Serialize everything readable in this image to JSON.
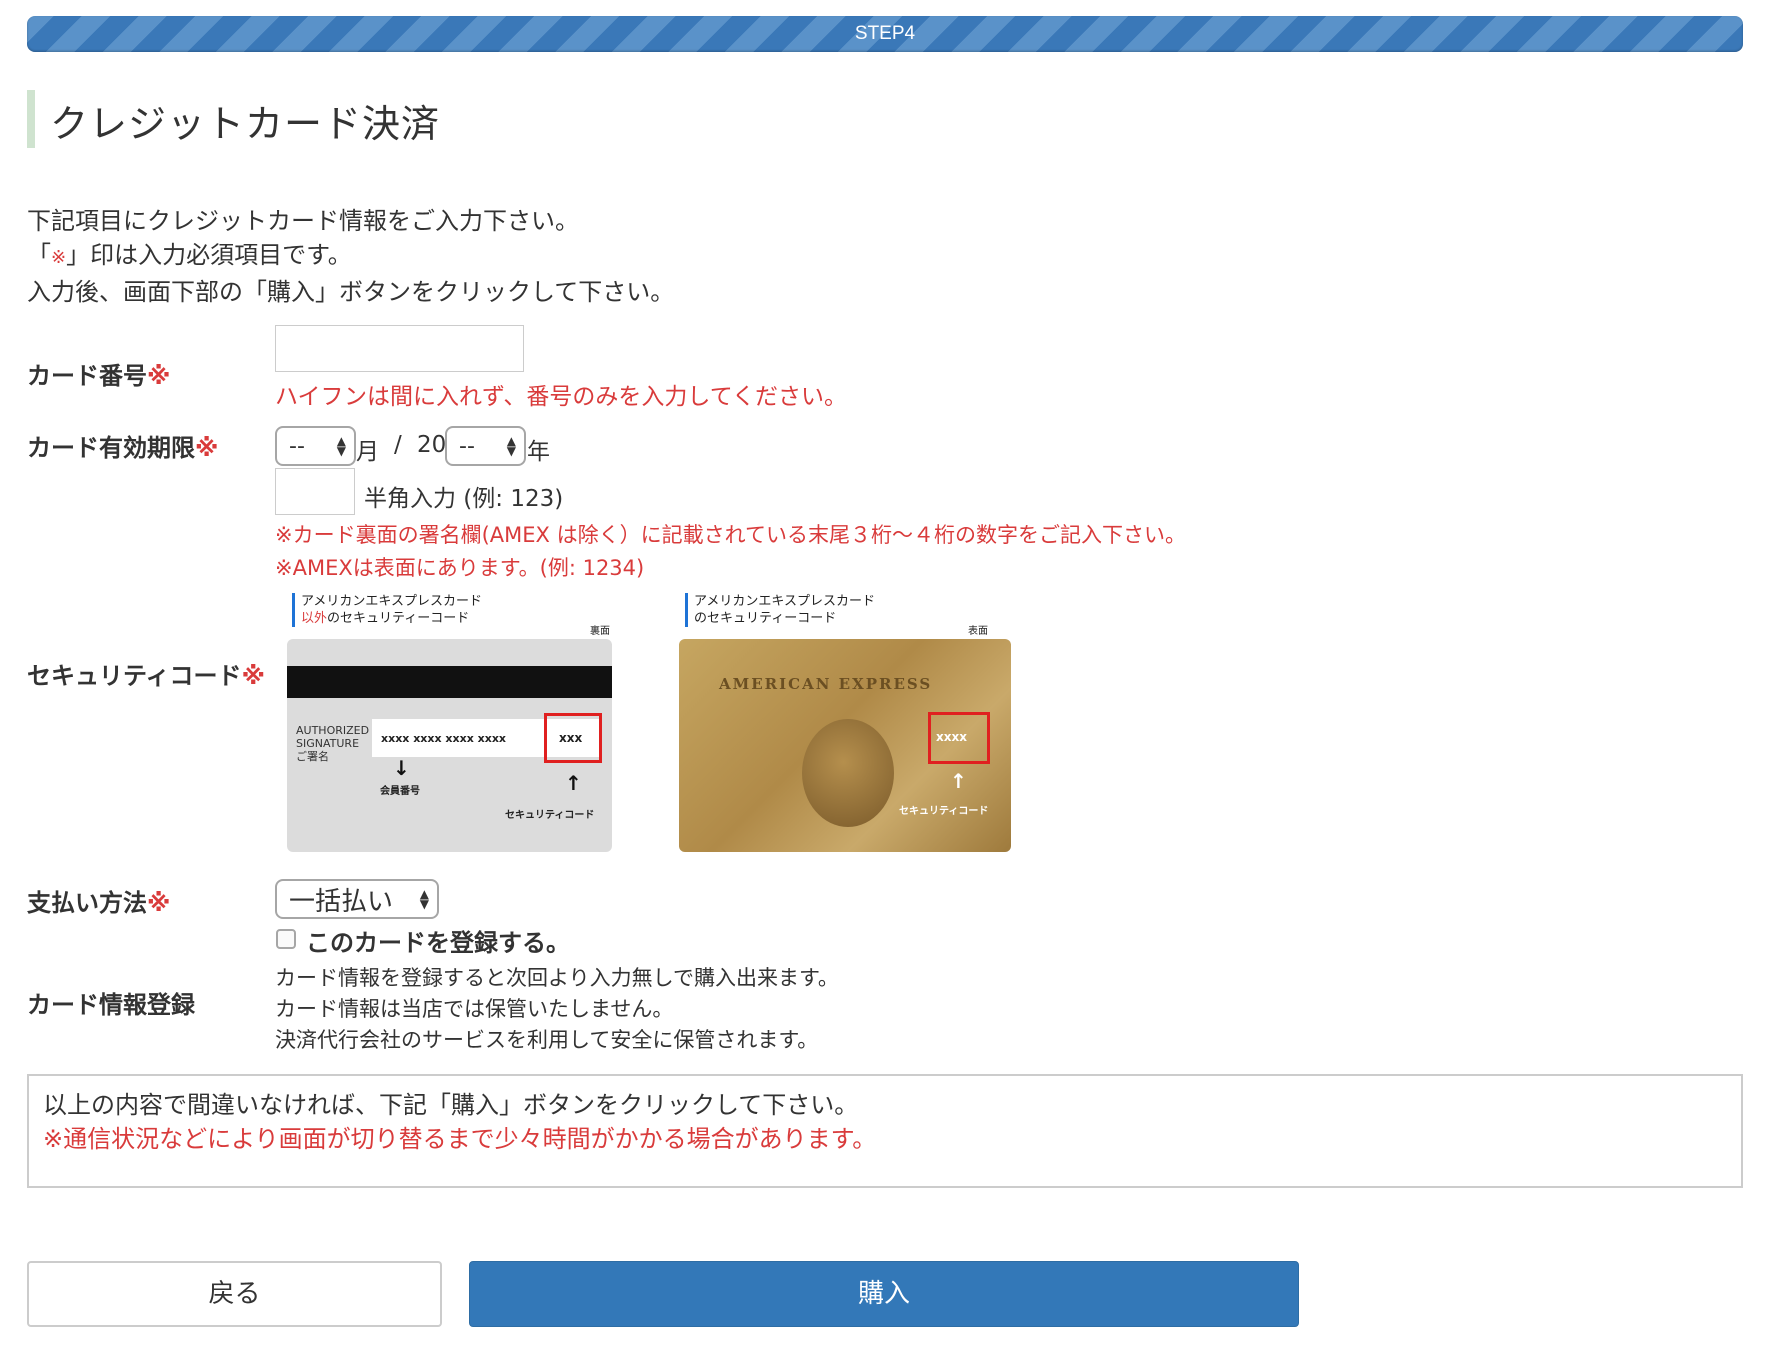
{
  "progress": {
    "step_label": "STEP4"
  },
  "page_title": "クレジットカード決済",
  "intro": {
    "line1": "下記項目にクレジットカード情報をご入力下さい。",
    "line2_open": "「",
    "line2_mark": "※",
    "line2_rest": "」印は入力必須項目です。",
    "line3": "入力後、画面下部の「購入」ボタンをクリックして下さい。"
  },
  "required_mark": "※",
  "card_number": {
    "label": "カード番号",
    "value": "",
    "hint": "ハイフンは間に入れず、番号のみを入力してください。"
  },
  "expiry": {
    "label": "カード有効期限",
    "month_value": "--",
    "month_suffix": "月",
    "separator": "/",
    "year_prefix": "20",
    "year_value": "--",
    "year_suffix": "年"
  },
  "security_code": {
    "label": "セキュリティコード",
    "value": "",
    "input_hint": "半角入力 (例: 123)",
    "note1": "※カード裏面の署名欄(AMEX は除く）に記載されている末尾３桁～４桁の数字をご記入下さい。",
    "note2": "※AMEXは表面にあります。(例: 1234)",
    "card_back": {
      "caption_line1": "アメリカンエキスプレスカード",
      "caption_line2_red": "以外",
      "caption_line2_rest": "のセキュリティーコード",
      "side": "裏面",
      "signature_label_1": "AUTHORIZED",
      "signature_label_2": "SIGNATURE",
      "signature_label_3": "ご署名",
      "number_mask": "xxxx xxxx xxxx xxxx",
      "code_mask": "xxx",
      "member_number_label": "会員番号",
      "security_code_label": "セキュリティコード"
    },
    "card_front": {
      "caption_line1": "アメリカンエキスプレスカード",
      "caption_line2": "のセキュリティーコード",
      "side": "表面",
      "brand": "AMERICAN EXPRESS",
      "code_mask": "xxxx",
      "security_code_label": "セキュリティコード"
    }
  },
  "payment": {
    "label": "支払い方法",
    "selected": "一括払い"
  },
  "register": {
    "checkbox_label": "このカードを登録する。",
    "label": "カード情報登録",
    "desc1": "カード情報を登録すると次回より入力無しで購入出来ます。",
    "desc2": "カード情報は当店では保管いたしません。",
    "desc3": "決済代行会社のサービスを利用して安全に保管されます。"
  },
  "confirm": {
    "line1": "以上の内容で間違いなければ、下記「購入」ボタンをクリックして下さい。",
    "line2": "※通信状況などにより画面が切り替るまで少々時間がかかる場合があります。"
  },
  "buttons": {
    "back": "戻る",
    "buy": "購入"
  },
  "colors": {
    "accent": "#3378b8",
    "required": "#d93b3b",
    "title_bar": "#cfe3cf"
  }
}
